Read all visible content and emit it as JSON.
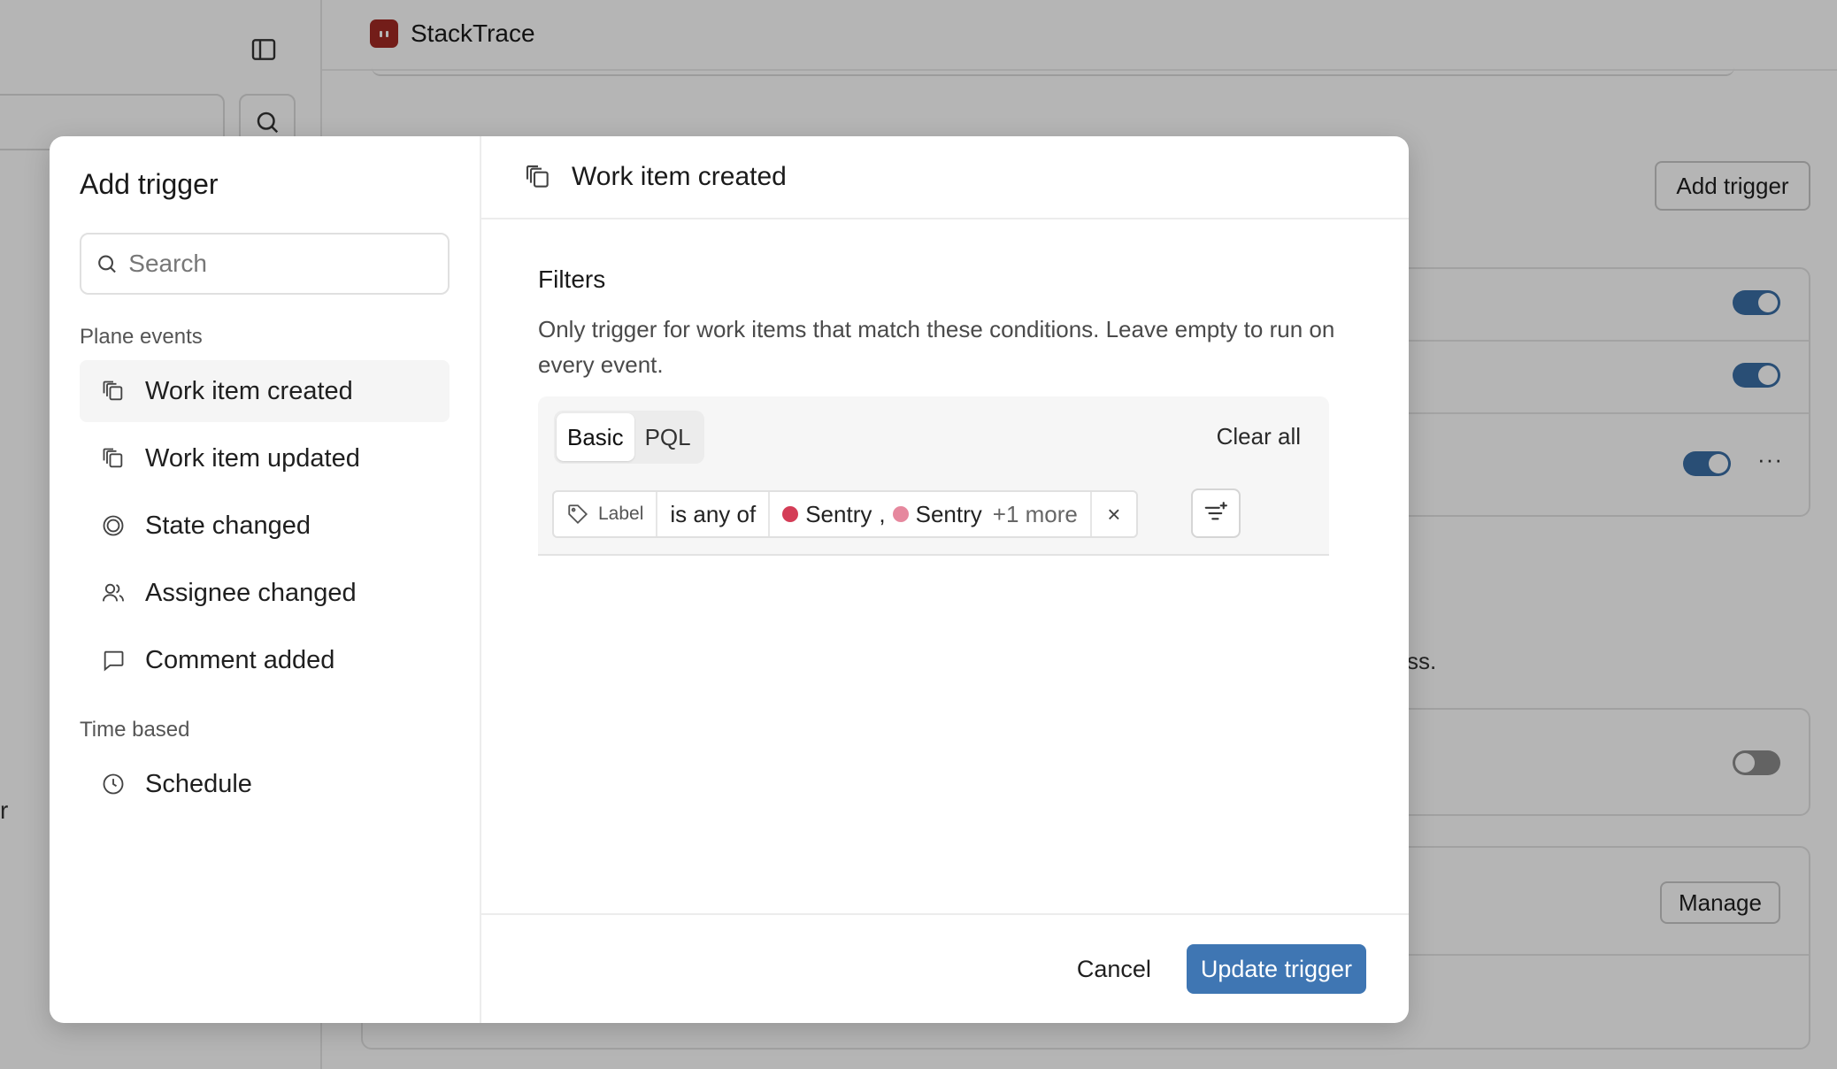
{
  "background": {
    "app_title": "StackTrace",
    "add_trigger_label": "Add trigger",
    "manage_label": "Manage",
    "trailing_text": "ss.",
    "edge_char": "r",
    "more_dots": "···",
    "toggles": [
      "on",
      "on",
      "on",
      "off"
    ]
  },
  "modal": {
    "title": "Add trigger",
    "search_placeholder": "Search",
    "sections": {
      "plane_events": "Plane events",
      "time_based": "Time based"
    },
    "events": {
      "created": "Work item created",
      "updated": "Work item updated",
      "state": "State changed",
      "assignee": "Assignee changed",
      "comment": "Comment added",
      "schedule": "Schedule"
    },
    "selected_event": "Work item created",
    "filters": {
      "title": "Filters",
      "description": "Only trigger for work items that match these conditions. Leave empty to run on every event.",
      "tabs": [
        "Basic",
        "PQL"
      ],
      "active_tab": "Basic",
      "clear_all": "Clear all",
      "condition": {
        "property": "Label",
        "operator": "is any of",
        "values": [
          {
            "name": "Sentry",
            "color": "#d43d57"
          },
          {
            "name": "Sentry",
            "color": "#e6889e"
          }
        ],
        "separator": ",",
        "more": "+1 more",
        "remove": "×"
      }
    },
    "footer": {
      "cancel": "Cancel",
      "submit": "Update trigger"
    }
  },
  "colors": {
    "accent": "#3f76b3",
    "brand_logo": "#a32a24"
  }
}
